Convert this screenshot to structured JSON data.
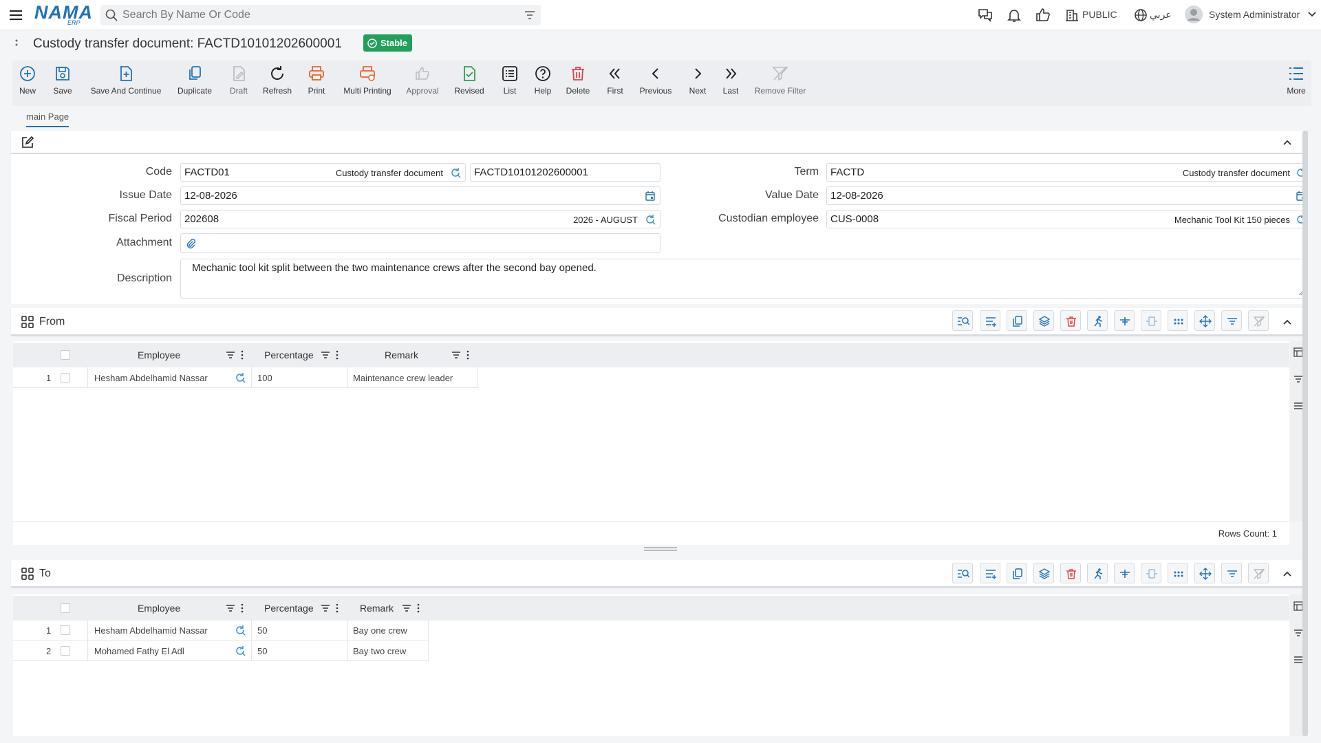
{
  "app": {
    "logo": "NAMA",
    "logo_sub": "ERP"
  },
  "search": {
    "placeholder": "Search By Name Or Code"
  },
  "topright": {
    "company": "PUBLIC",
    "language": "عربي",
    "user": "System Administrator"
  },
  "page": {
    "title": "Custody transfer document: FACTD10101202600001",
    "status": "Stable"
  },
  "toolbar": {
    "new": "New",
    "save": "Save",
    "save_continue": "Save And Continue",
    "duplicate": "Duplicate",
    "draft": "Draft",
    "refresh": "Refresh",
    "print": "Print",
    "multi_print": "Multi Printing",
    "approval": "Approval",
    "revised": "Revised",
    "list": "List",
    "help": "Help",
    "delete": "Delete",
    "first": "First",
    "previous": "Previous",
    "next": "Next",
    "last": "Last",
    "remove_filter": "Remove Filter",
    "more": "More"
  },
  "tabs": {
    "main": "main Page"
  },
  "form": {
    "code_label": "Code",
    "code_value": "FACTD01",
    "code_desc": "Custody transfer document",
    "code_number": "FACTD10101202600001",
    "issue_label": "Issue Date",
    "issue_value": "12-08-2026",
    "fiscal_label": "Fiscal Period",
    "fiscal_value": "202608",
    "fiscal_desc": "2026 - AUGUST",
    "attachment_label": "Attachment",
    "term_label": "Term",
    "term_value": "FACTD",
    "term_desc": "Custody transfer document",
    "value_date_label": "Value Date",
    "value_date_value": "12-08-2026",
    "custodian_label": "Custodian employee",
    "custodian_value": "CUS-0008",
    "custodian_desc": "Mechanic Tool Kit 150 pieces",
    "description_label": "Description",
    "description_value": "Mechanic tool kit split between the two maintenance crews after the second bay opened."
  },
  "from": {
    "title": "From",
    "columns": {
      "employee": "Employee",
      "percentage": "Percentage",
      "remark": "Remark"
    },
    "rows": [
      {
        "n": "1",
        "employee": "Hesham Abdelhamid Nassar",
        "percentage": "100",
        "remark": "Maintenance crew leader"
      }
    ],
    "rows_count": "Rows Count: 1"
  },
  "to": {
    "title": "To",
    "columns": {
      "employee": "Employee",
      "percentage": "Percentage",
      "remark": "Remark"
    },
    "rows": [
      {
        "n": "1",
        "employee": "Hesham Abdelhamid Nassar",
        "percentage": "50",
        "remark": "Bay one crew"
      },
      {
        "n": "2",
        "employee": "Mohamed Fathy El Adl",
        "percentage": "50",
        "remark": "Bay two crew"
      }
    ]
  },
  "colors": {
    "brand": "#1f73b7",
    "status": "#22a05b",
    "delete": "#e04444",
    "print": "#e8632b",
    "revised": "#2f9e54"
  }
}
